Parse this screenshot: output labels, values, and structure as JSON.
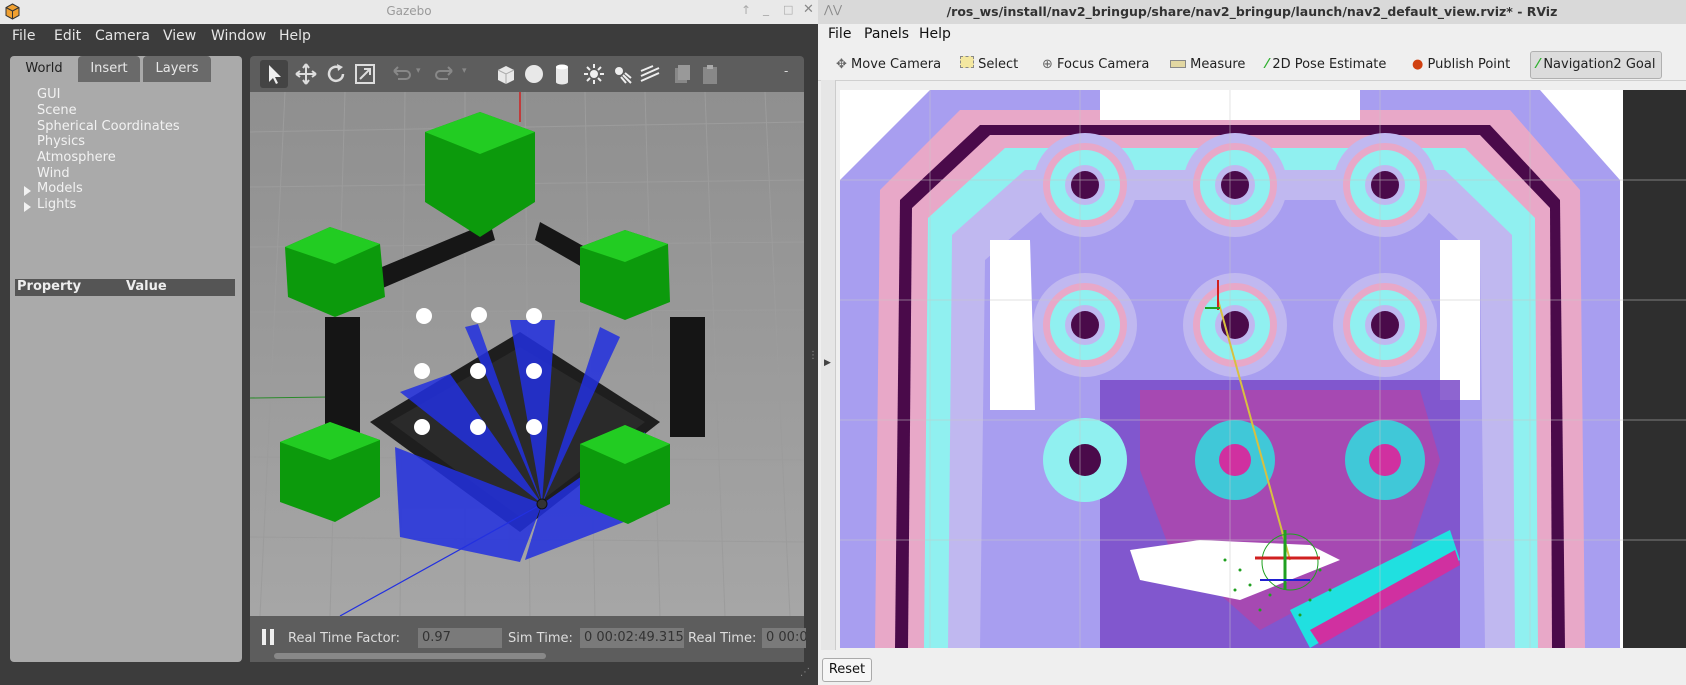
{
  "gazebo": {
    "title": "Gazebo",
    "menu": [
      "File",
      "Edit",
      "Camera",
      "View",
      "Window",
      "Help"
    ],
    "tabs": [
      "World",
      "Insert",
      "Layers"
    ],
    "active_tab": "World",
    "tree": [
      "GUI",
      "Scene",
      "Spherical Coordinates",
      "Physics",
      "Atmosphere",
      "Wind"
    ],
    "tree_expandable": [
      "Models",
      "Lights"
    ],
    "property_header": {
      "property": "Property",
      "value": "Value"
    },
    "toolbar_icons": [
      "select-arrow-icon",
      "translate-icon",
      "rotate-icon",
      "scale-icon",
      "undo-icon",
      "redo-icon",
      "box-icon",
      "sphere-icon",
      "cylinder-icon",
      "point-light-icon",
      "spot-light-icon",
      "directional-light-icon",
      "copy-icon",
      "paste-icon"
    ],
    "status": {
      "pause_label": "Pause",
      "rtf_label": "Real Time Factor:",
      "rtf_value": "0.97",
      "sim_time_label": "Sim Time:",
      "sim_time_value": "0 00:02:49.315",
      "real_time_label": "Real Time:",
      "real_time_value": "0 00:0"
    }
  },
  "rviz": {
    "title": "/ros_ws/install/nav2_bringup/share/nav2_bringup/launch/nav2_default_view.rviz* - RViz",
    "menu": [
      "File",
      "Panels",
      "Help"
    ],
    "tools": [
      {
        "label": "Move Camera",
        "icon": "move-camera-icon"
      },
      {
        "label": "Select",
        "icon": "select-icon"
      },
      {
        "label": "Focus Camera",
        "icon": "focus-camera-icon"
      },
      {
        "label": "Measure",
        "icon": "measure-icon"
      },
      {
        "label": "2D Pose Estimate",
        "icon": "pose-estimate-icon"
      },
      {
        "label": "Publish Point",
        "icon": "publish-point-icon"
      },
      {
        "label": "Navigation2 Goal",
        "icon": "nav-goal-icon"
      }
    ],
    "active_tool": "Navigation2 Goal",
    "reset_label": "Reset"
  }
}
